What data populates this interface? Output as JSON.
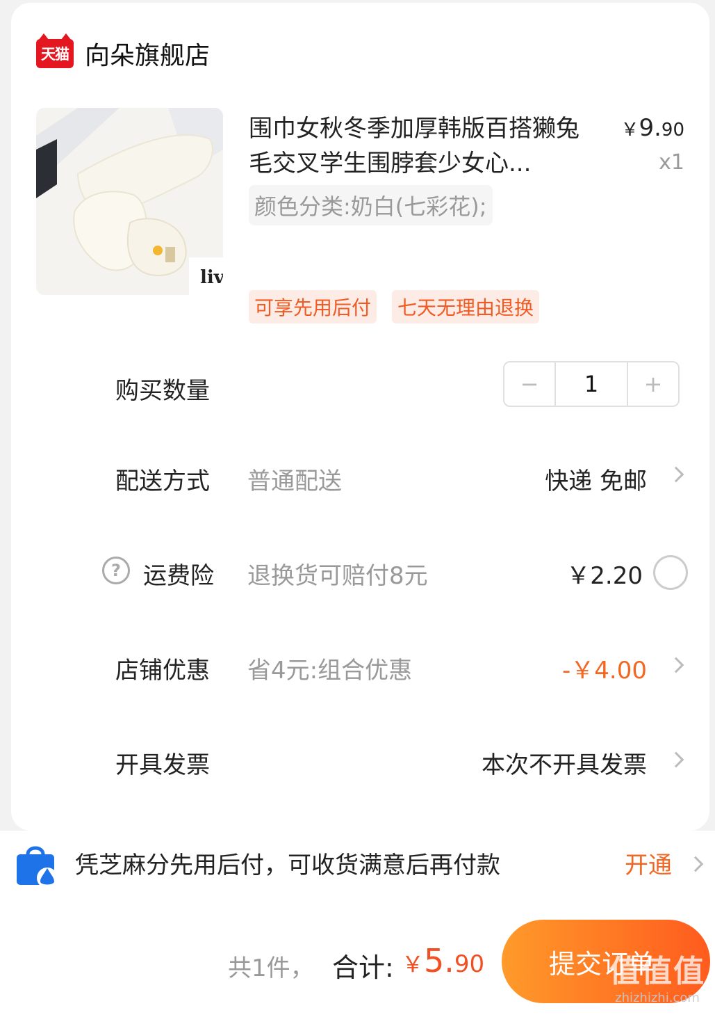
{
  "store": {
    "logo_text": "天猫",
    "name": "向朵旗舰店"
  },
  "product": {
    "title": "围巾女秋冬季加厚韩版百搭獭兔毛交叉学生围脖套少女心...",
    "price_yen": "￥",
    "price_int": "9.",
    "price_dec": "90",
    "quantity_label": "x1",
    "sku": "颜色分类:奶白(七彩花);",
    "image_label_text": "liv",
    "tags": [
      "可享先用后付",
      "七天无理由退换"
    ]
  },
  "rows": {
    "quantity": {
      "label": "购买数量",
      "minus": "−",
      "value": "1",
      "plus": "+"
    },
    "shipping": {
      "label": "配送方式",
      "sub": "普通配送",
      "value": "快递 免邮"
    },
    "insurance": {
      "help": "?",
      "label": "运费险",
      "sub": "退换货可赔付8元",
      "value": "￥2.20"
    },
    "discount": {
      "label": "店铺优惠",
      "sub": "省4元:组合优惠",
      "value": "-￥4.00"
    },
    "invoice": {
      "label": "开具发票",
      "value": "本次不开具发票"
    }
  },
  "promo": {
    "text": "凭芝麻分先用后付，可收货满意后再付款",
    "action": "开通"
  },
  "footer": {
    "count": "共1件，",
    "total_label": "合计:",
    "total_yen": "￥",
    "total_int": "5.",
    "total_dec": "90",
    "submit": "提交订单"
  },
  "watermark": {
    "logo": "值值值",
    "url": "zhizhizhi.com"
  },
  "colors": {
    "accent": "#f26722",
    "price_red": "#f25022",
    "tmall_red": "#e4161f"
  }
}
